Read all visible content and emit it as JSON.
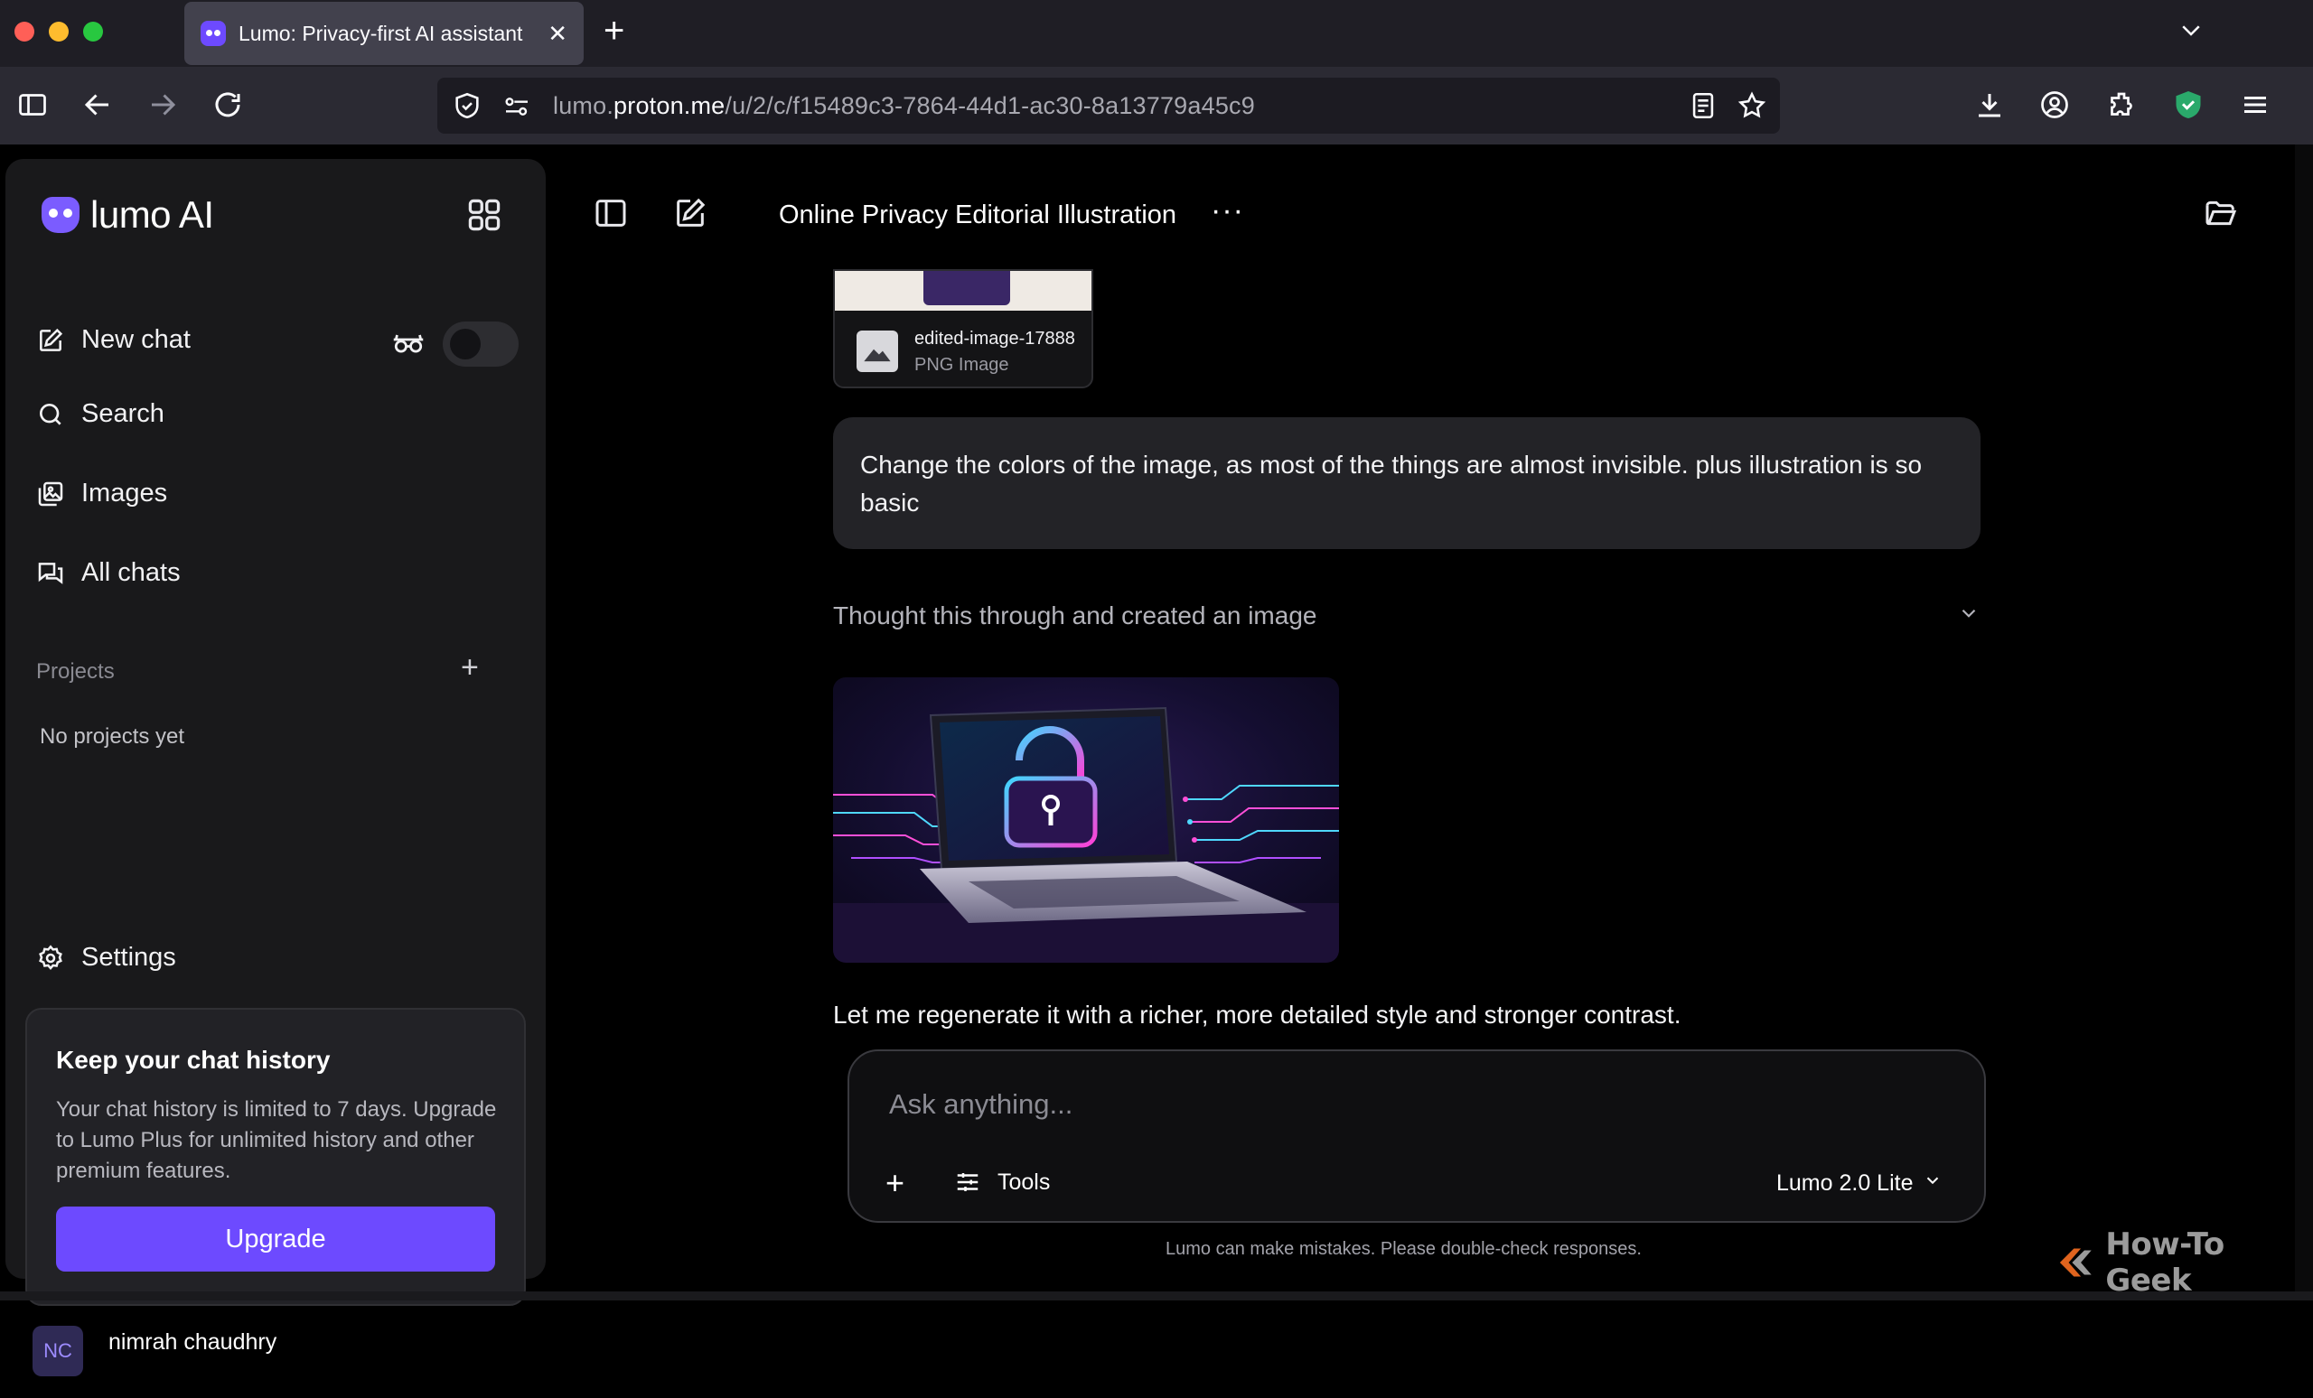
{
  "browser": {
    "tab_title": "Lumo: Privacy-first AI assistant",
    "url_prefix": "lumo.",
    "url_domain": "proton.me",
    "url_path": "/u/2/c/f15489c3-7864-44d1-ac30-8a13779a45c9"
  },
  "sidebar": {
    "logo_text": "lumo AI",
    "items": [
      {
        "label": "New chat"
      },
      {
        "label": "Search"
      },
      {
        "label": "Images"
      },
      {
        "label": "All chats"
      }
    ],
    "projects_label": "Projects",
    "no_projects": "No projects yet",
    "settings_label": "Settings",
    "promo": {
      "title": "Keep your chat history",
      "body": "Your chat history is limited to 7 days. Upgrade to Lumo Plus for unlimited history and other premium features.",
      "button": "Upgrade"
    },
    "user": {
      "initials": "NC",
      "name": "nimrah chaudhry"
    }
  },
  "chat": {
    "title": "Online Privacy Editorial Illustration",
    "more": "···",
    "attachment": {
      "filename": "edited-image-17888",
      "type": "PNG Image"
    },
    "user_message": "Change the colors of the image, as most of the things are almost invisible. plus illustration is so basic",
    "thought_label": "Thought this through and created an image",
    "assistant_text": "Let me regenerate it with a richer, more detailed style and stronger contrast."
  },
  "composer": {
    "placeholder": "Ask anything...",
    "tools_label": "Tools",
    "model_label": "Lumo 2.0 Lite"
  },
  "disclaimer": "Lumo can make mistakes. Please double-check responses.",
  "watermark": "How-To Geek",
  "colors": {
    "accent": "#6d4aff",
    "background": "#000000",
    "sidebar": "#19191b"
  }
}
